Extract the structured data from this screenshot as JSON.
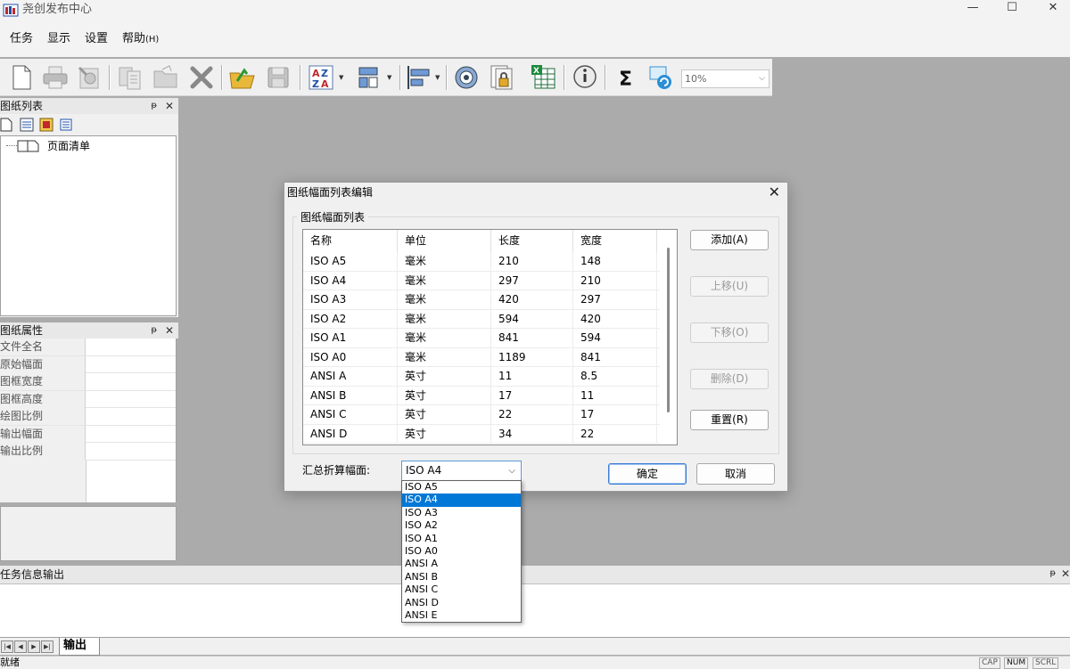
{
  "window": {
    "title": "尧创发布中心",
    "minimize": "—",
    "maximize": "☐",
    "close": "✕"
  },
  "menu": [
    {
      "label": "任务",
      "hotkey": ""
    },
    {
      "label": "显示",
      "hotkey": ""
    },
    {
      "label": "设置",
      "hotkey": ""
    },
    {
      "label": "帮助",
      "hotkey": "(H)"
    }
  ],
  "toolbar": {
    "zoom_value": "10%"
  },
  "drawing_list_panel": {
    "title": "图纸列表",
    "pin": "ᵽ",
    "close": "✕",
    "tree_root": "页面清单"
  },
  "drawing_props_panel": {
    "title": "图纸属性",
    "pin": "ᵽ",
    "close": "✕",
    "properties": [
      "文件全名",
      "原始幅面",
      "图框宽度",
      "图框高度",
      "绘图比例",
      "输出幅面",
      "输出比例"
    ]
  },
  "output_panel": {
    "title": "任务信息输出",
    "pin": "ᵽ",
    "close": "✕",
    "tab": "输出",
    "status": "就绪",
    "indicators": [
      "CAP",
      "NUM",
      "SCRL"
    ]
  },
  "dialog": {
    "title": "图纸幅面列表编辑",
    "close": "✕",
    "group_label": "图纸幅面列表",
    "columns": [
      "名称",
      "单位",
      "长度",
      "宽度"
    ],
    "rows": [
      [
        "ISO A5",
        "毫米",
        "210",
        "148"
      ],
      [
        "ISO A4",
        "毫米",
        "297",
        "210"
      ],
      [
        "ISO A3",
        "毫米",
        "420",
        "297"
      ],
      [
        "ISO A2",
        "毫米",
        "594",
        "420"
      ],
      [
        "ISO A1",
        "毫米",
        "841",
        "594"
      ],
      [
        "ISO A0",
        "毫米",
        "1189",
        "841"
      ],
      [
        "ANSI A",
        "英寸",
        "11",
        "8.5"
      ],
      [
        "ANSI B",
        "英寸",
        "17",
        "11"
      ],
      [
        "ANSI C",
        "英寸",
        "22",
        "17"
      ],
      [
        "ANSI D",
        "英寸",
        "34",
        "22"
      ]
    ],
    "buttons": {
      "add": "添加(A)",
      "move_up": "上移(U)",
      "move_down": "下移(O)",
      "delete": "删除(D)",
      "reset": "重置(R)",
      "ok": "确定",
      "cancel": "取消"
    },
    "summary_label": "汇总折算幅面:",
    "summary_value": "ISO A4",
    "summary_options": [
      "ISO A5",
      "ISO A4",
      "ISO A3",
      "ISO A2",
      "ISO A1",
      "ISO A0",
      "ANSI A",
      "ANSI B",
      "ANSI C",
      "ANSI D",
      "ANSI E"
    ],
    "selected_option": "ISO A4"
  },
  "colors": {
    "accent": "#0078d7",
    "workspace": "#ababab",
    "panel": "#f0f0f0"
  }
}
